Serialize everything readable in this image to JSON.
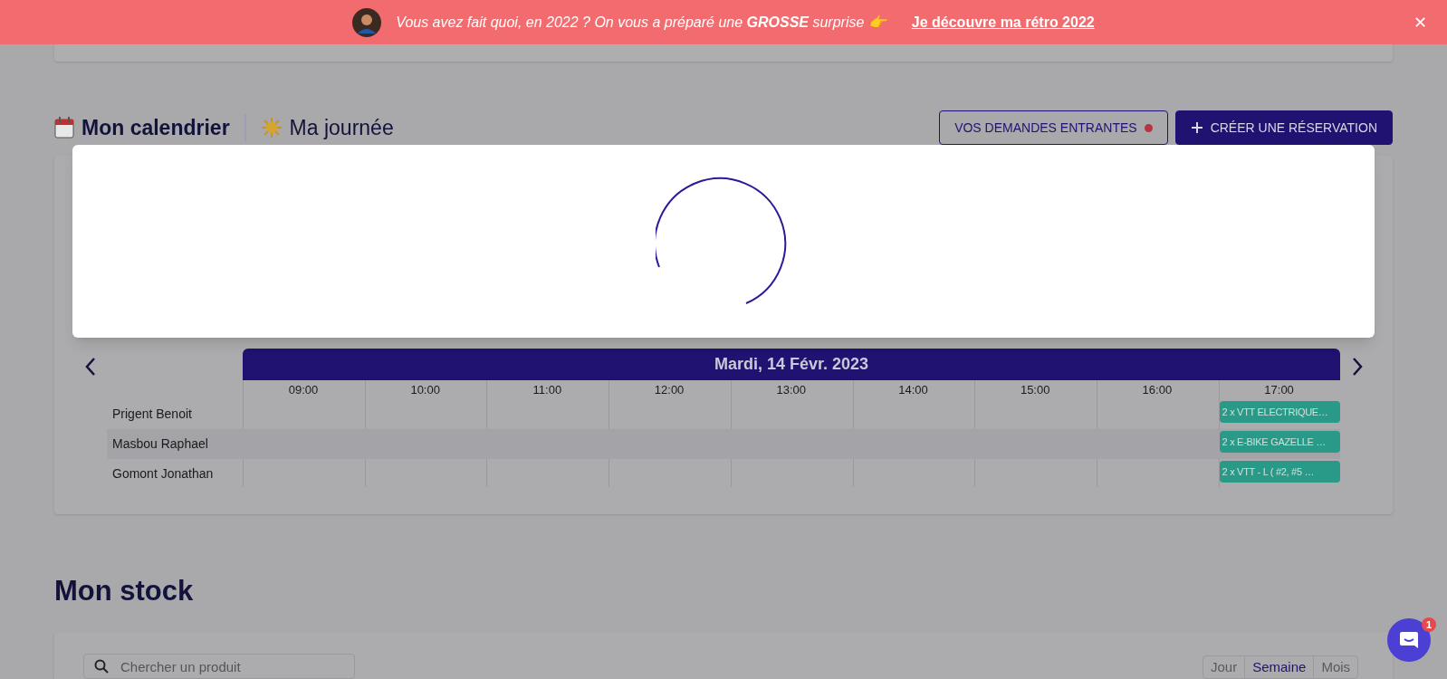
{
  "banner": {
    "text": "Vous avez fait quoi, en 2022 ? On vous a préparé une **GROSSE** surprise 👉",
    "link": "Je découvre ma rétro 2022",
    "close": "✕"
  },
  "calendar": {
    "tabs": [
      {
        "label": "Mon calendrier",
        "selected": true
      },
      {
        "label": "Ma journée",
        "selected": false
      }
    ],
    "buttons": [
      {
        "kind": "outline",
        "label": "VOS DEMANDES ENTRANTES",
        "dot": true
      },
      {
        "kind": "primary",
        "label": "CRÉER UNE RÉSERVATION",
        "dot": false
      }
    ],
    "date": "Mardi, 14 Févr. 2023",
    "hours": [
      "09:00",
      "10:00",
      "11:00",
      "12:00",
      "13:00",
      "14:00",
      "15:00",
      "16:00",
      "17:00"
    ],
    "rows": [
      {
        "name": "Prigent Benoit",
        "events": [
          {
            "label": "2 x VTT ELECTRIQUE…"
          }
        ]
      },
      {
        "name": "Masbou Raphael",
        "events": [
          {
            "label": "2 x E-BIKE GAZELLE …"
          }
        ]
      },
      {
        "name": "Gomont Jonathan",
        "events": [
          {
            "label": "2 x VTT - L ( #2, #5 …"
          }
        ]
      }
    ]
  },
  "loading_dialog": {
    "spinner": true
  },
  "stock": {
    "title": "Mon stock",
    "search": {
      "placeholder": "Chercher un produit"
    },
    "views": [
      {
        "label": "Jour",
        "selected": false
      },
      {
        "label": "Semaine",
        "selected": true
      },
      {
        "label": "Mois",
        "selected": false
      }
    ]
  },
  "chat": {
    "badge": "1"
  }
}
